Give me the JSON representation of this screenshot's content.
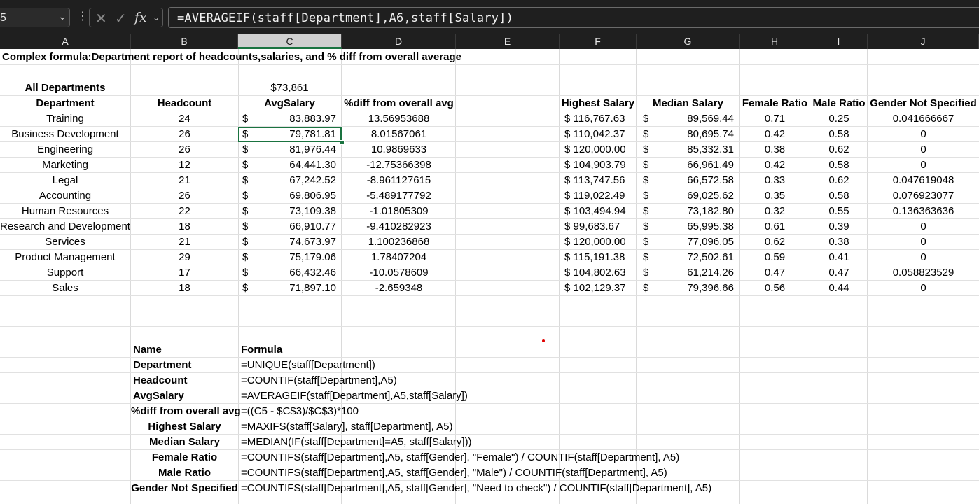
{
  "formula_bar": {
    "name_box": "5",
    "formula": "=AVERAGEIF(staff[Department],A6,staff[Salary])",
    "icons": {
      "cancel": "x-icon",
      "enter": "check-icon",
      "function": "fx-icon"
    },
    "fx_label": "fx"
  },
  "columns": [
    "A",
    "B",
    "C",
    "D",
    "E",
    "F",
    "G",
    "H",
    "I",
    "J"
  ],
  "selected_column": "C",
  "selected_cell": "C6",
  "sheet": {
    "title": "Complex formula:Department report of headcounts,salaries, and % diff from overall average",
    "all_departments_label": "All Departments",
    "overall_avg": "$73,861",
    "headers": {
      "department": "Department",
      "headcount": "Headcount",
      "avg_salary": "AvgSalary",
      "pct_diff": "%diff from overall avg",
      "highest_salary": "Highest Salary",
      "median_salary": "Median Salary",
      "female_ratio": "Female Ratio",
      "male_ratio": "Male Ratio",
      "gender_not_specified": "Gender Not Specified"
    },
    "currency_symbol": "$",
    "rows": [
      {
        "dept": "Training",
        "headcount": "24",
        "avg": "83,883.97",
        "diff": "13.56953688",
        "highest": "$ 116,767.63",
        "median": "89,569.44",
        "female": "0.71",
        "male": "0.25",
        "ns": "0.041666667"
      },
      {
        "dept": "Business Development",
        "headcount": "26",
        "avg": "79,781.81",
        "diff": "8.01567061",
        "highest": "$ 110,042.37",
        "median": "80,695.74",
        "female": "0.42",
        "male": "0.58",
        "ns": "0"
      },
      {
        "dept": "Engineering",
        "headcount": "26",
        "avg": "81,976.44",
        "diff": "10.9869633",
        "highest": "$ 120,000.00",
        "median": "85,332.31",
        "female": "0.38",
        "male": "0.62",
        "ns": "0"
      },
      {
        "dept": "Marketing",
        "headcount": "12",
        "avg": "64,441.30",
        "diff": "-12.75366398",
        "highest": "$ 104,903.79",
        "median": "66,961.49",
        "female": "0.42",
        "male": "0.58",
        "ns": "0"
      },
      {
        "dept": "Legal",
        "headcount": "21",
        "avg": "67,242.52",
        "diff": "-8.961127615",
        "highest": "$ 113,747.56",
        "median": "66,572.58",
        "female": "0.33",
        "male": "0.62",
        "ns": "0.047619048"
      },
      {
        "dept": "Accounting",
        "headcount": "26",
        "avg": "69,806.95",
        "diff": "-5.489177792",
        "highest": "$ 119,022.49",
        "median": "69,025.62",
        "female": "0.35",
        "male": "0.58",
        "ns": "0.076923077"
      },
      {
        "dept": "Human Resources",
        "headcount": "22",
        "avg": "73,109.38",
        "diff": "-1.01805309",
        "highest": "$ 103,494.94",
        "median": "73,182.80",
        "female": "0.32",
        "male": "0.55",
        "ns": "0.136363636"
      },
      {
        "dept": "Research and Development",
        "headcount": "18",
        "avg": "66,910.77",
        "diff": "-9.410282923",
        "highest": "$  99,683.67",
        "median": "65,995.38",
        "female": "0.61",
        "male": "0.39",
        "ns": "0"
      },
      {
        "dept": "Services",
        "headcount": "21",
        "avg": "74,673.97",
        "diff": "1.100236868",
        "highest": "$ 120,000.00",
        "median": "77,096.05",
        "female": "0.62",
        "male": "0.38",
        "ns": "0"
      },
      {
        "dept": "Product Management",
        "headcount": "29",
        "avg": "75,179.06",
        "diff": "1.78407204",
        "highest": "$ 115,191.38",
        "median": "72,502.61",
        "female": "0.59",
        "male": "0.41",
        "ns": "0"
      },
      {
        "dept": "Support",
        "headcount": "17",
        "avg": "66,432.46",
        "diff": "-10.0578609",
        "highest": "$ 104,802.63",
        "median": "61,214.26",
        "female": "0.47",
        "male": "0.47",
        "ns": "0.058823529"
      },
      {
        "dept": "Sales",
        "headcount": "18",
        "avg": "71,897.10",
        "diff": "-2.659348",
        "highest": "$ 102,129.37",
        "median": "79,396.66",
        "female": "0.56",
        "male": "0.44",
        "ns": "0"
      }
    ],
    "formula_table": {
      "name_header": "Name",
      "formula_header": "Formula",
      "items": [
        {
          "name": "Department",
          "formula": "=UNIQUE(staff[Department])"
        },
        {
          "name": "Headcount",
          "formula": "=COUNTIF(staff[Department],A5)"
        },
        {
          "name": "AvgSalary",
          "formula": "=AVERAGEIF(staff[Department],A5,staff[Salary])"
        },
        {
          "name": "%diff from overall avg",
          "formula": "=((C5 - $C$3)/$C$3)*100"
        },
        {
          "name": "Highest Salary",
          "formula": "=MAXIFS(staff[Salary], staff[Department], A5)"
        },
        {
          "name": "Median Salary",
          "formula": "=MEDIAN(IF(staff[Department]=A5, staff[Salary]))"
        },
        {
          "name": "Female Ratio",
          "formula": "=COUNTIFS(staff[Department],A5, staff[Gender], \"Female\") / COUNTIF(staff[Department], A5)"
        },
        {
          "name": "Male Ratio",
          "formula": "=COUNTIFS(staff[Department],A5, staff[Gender], \"Male\") / COUNTIF(staff[Department], A5)"
        },
        {
          "name": "Gender Not Specified",
          "formula": "=COUNTIFS(staff[Department],A5, staff[Gender], \"Need to check\") / COUNTIF(staff[Department], A5)"
        }
      ]
    }
  },
  "colors": {
    "accent": "#1a7340",
    "header_bg": "#1f1f1f",
    "selected_header": "#cfcfcf"
  }
}
